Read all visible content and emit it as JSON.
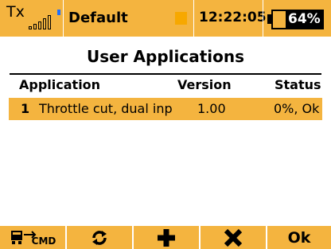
{
  "status_bar": {
    "tx_label": "Tx",
    "signal_bars": 5,
    "model_name": "Default",
    "time": "12:22:05",
    "battery_percent_text": "64%",
    "battery_level": 0.64
  },
  "page": {
    "title": "User Applications"
  },
  "table": {
    "headers": {
      "application": "Application",
      "version": "Version",
      "status": "Status"
    },
    "rows": [
      {
        "index": "1",
        "name": "Throttle cut, dual inp",
        "version": "1.00",
        "status": "0%, Ok"
      }
    ]
  },
  "footer": {
    "cmd_label": "CMD",
    "ok_label": "Ok"
  },
  "colors": {
    "accent": "#f4b43f",
    "signal_blue": "#1f6fff"
  },
  "icons": {
    "cmd": "cmd-transfer-icon",
    "refresh": "refresh-icon",
    "add": "plus-icon",
    "delete": "x-icon"
  }
}
